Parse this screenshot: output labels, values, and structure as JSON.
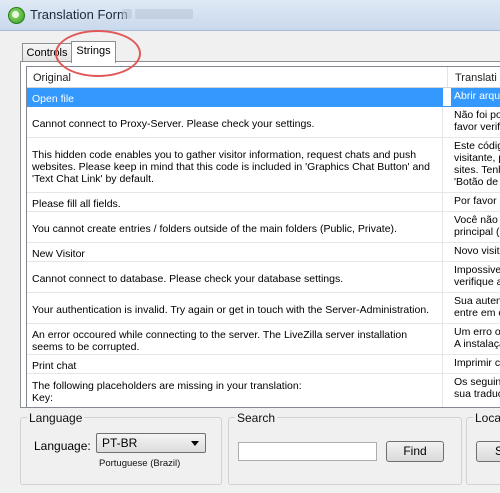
{
  "window": {
    "title": "Translation Form"
  },
  "tabs": [
    {
      "label": "Controls"
    },
    {
      "label": "Strings"
    }
  ],
  "grid": {
    "columns": {
      "original": "Original",
      "translation": "Translati"
    },
    "rows": [
      {
        "original": "Open file",
        "translation": "Abrir arqui"
      },
      {
        "original": "Cannot connect to Proxy-Server. Please check your settings.",
        "translation": "Não foi po\nfavor verifi"
      },
      {
        "original": "This hidden code enables you to gather visitor information, request chats and push websites. Please keep in mind that this code is included in 'Graphics Chat Button' and 'Text Chat Link' by default.",
        "translation": "Este códig\nvisitante, p\nsites. Tenh\n'Botão de "
      },
      {
        "original": "Please fill all fields.",
        "translation": "Por favor p"
      },
      {
        "original": "You cannot create entries / folders outside of the main folders (Public, Private).",
        "translation": "Você não\nprincipal (P"
      },
      {
        "original": "New Visitor",
        "translation": "Novo visita"
      },
      {
        "original": "Cannot connect to database. Please check your database settings.",
        "translation": "Impossivel\nverifique a"
      },
      {
        "original": "Your authentication is invalid. Try again or get in touch with the Server-Administration.",
        "translation": "Sua auten\nentre em c"
      },
      {
        "original": "An error occoured while connecting to the server. The LiveZilla server installation seems to be corrupted.",
        "translation": "Um erro oc\nA instalaçã"
      },
      {
        "original": "Print chat",
        "translation": "Imprimir ch"
      },
      {
        "original": "The following placeholders are missing in your translation:\nKey:",
        "translation": "Os seguint\nsua traduçã"
      }
    ]
  },
  "language_group": {
    "title": "Language",
    "label": "Language:",
    "selected": "PT-BR",
    "caption": "Portuguese (Brazil)"
  },
  "search_group": {
    "title": "Search",
    "value": "",
    "find_label": "Find"
  },
  "local_group": {
    "title": "Local",
    "button_label": "S"
  }
}
